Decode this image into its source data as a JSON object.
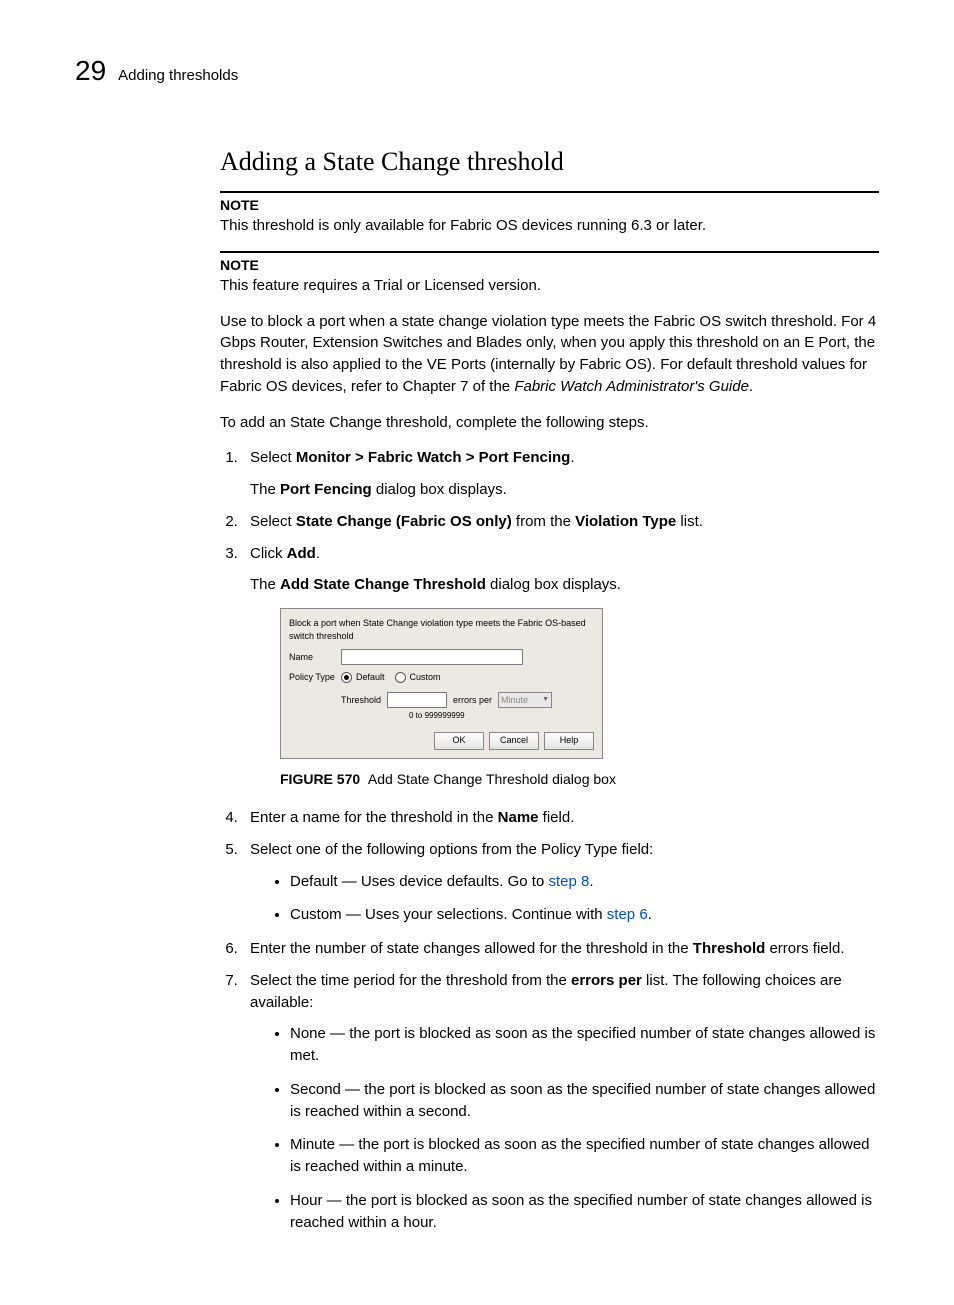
{
  "header": {
    "chapter_number": "29",
    "title": "Adding thresholds"
  },
  "section_title": "Adding a State Change threshold",
  "notes": [
    {
      "label": "NOTE",
      "body": "This threshold is only available for Fabric OS devices running 6.3 or later."
    },
    {
      "label": "NOTE",
      "body": "This feature requires a Trial or Licensed version."
    }
  ],
  "intro1_a": "Use to block a port when a state change violation type meets the Fabric OS switch threshold. For 4 Gbps Router, Extension Switches and Blades only, when you apply this threshold on an E Port, the threshold is also applied to the VE Ports (internally by Fabric OS). For default threshold values for Fabric OS devices, refer to Chapter 7 of the ",
  "intro1_i": "Fabric Watch Administrator's Guide",
  "intro1_b": ".",
  "intro2": "To add an State Change threshold, complete the following steps.",
  "step1": {
    "pre": "Select ",
    "bold": "Monitor > Fabric Watch > Port Fencing",
    "post": ".",
    "sub_pre": "The ",
    "sub_bold": "Port Fencing",
    "sub_post": " dialog box displays."
  },
  "step2": {
    "pre": "Select ",
    "bold1": "State Change (Fabric OS only)",
    "mid": " from the ",
    "bold2": "Violation Type",
    "post": " list."
  },
  "step3": {
    "pre": "Click ",
    "bold": "Add",
    "post": ".",
    "sub_pre": "The ",
    "sub_bold": "Add State Change Threshold",
    "sub_post": " dialog box displays."
  },
  "dialog": {
    "header": "Block a port when State Change violation type meets the Fabric OS-based switch threshold",
    "name_label": "Name",
    "policy_label": "Policy Type",
    "radio_default": "Default",
    "radio_custom": "Custom",
    "threshold_label": "Threshold",
    "errors_per": "errors per",
    "dd_value": "Minute",
    "range": "0 to 999999999",
    "ok": "OK",
    "cancel": "Cancel",
    "help": "Help"
  },
  "figure": {
    "label": "FIGURE 570",
    "caption": "Add State Change Threshold dialog box"
  },
  "step4": {
    "pre": "Enter a name for the threshold in the ",
    "bold": "Name",
    "post": " field."
  },
  "step5": {
    "text": "Select one of the following options from the Policy Type field:",
    "b1_pre": "Default — Uses device defaults. Go to ",
    "b1_link": "step 8",
    "b1_post": ".",
    "b2_pre": "Custom — Uses your selections. Continue with ",
    "b2_link": "step 6",
    "b2_post": "."
  },
  "step6": {
    "pre": "Enter the number of state changes allowed for the threshold in the ",
    "bold": "Threshold",
    "post": " errors field."
  },
  "step7": {
    "pre": "Select the time period for the threshold from the ",
    "bold": "errors per",
    "post": " list. The following choices are available:",
    "opts": [
      "None — the port is blocked as soon as the specified number of state changes allowed is met.",
      "Second — the port is blocked as soon as the specified number of state changes allowed is reached within a second.",
      "Minute — the port is blocked as soon as the specified number of state changes allowed is reached within a minute.",
      "Hour — the port is blocked as soon as the specified number of state changes allowed is reached within a hour."
    ]
  }
}
